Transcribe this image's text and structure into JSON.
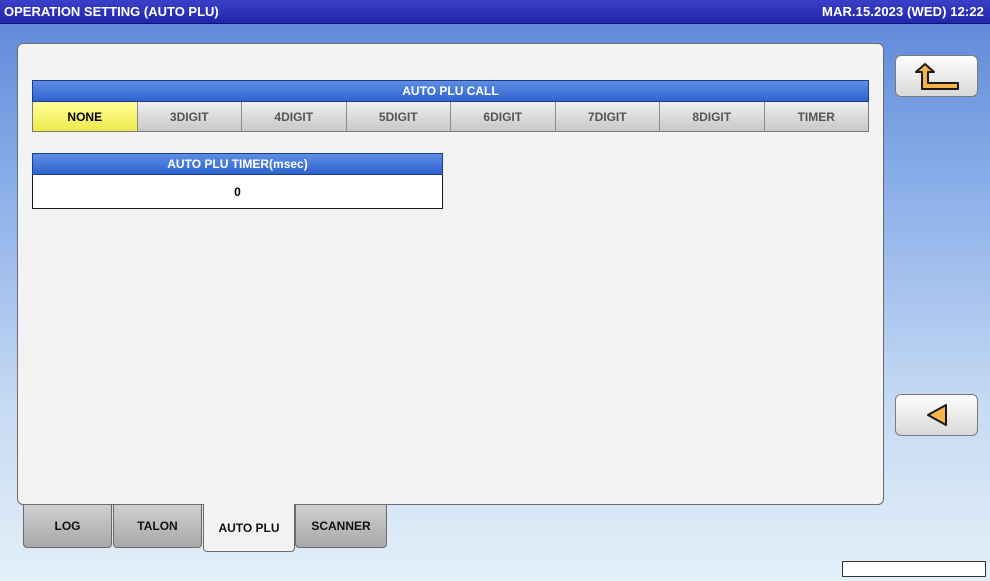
{
  "title": "OPERATION SETTING (AUTO PLU)",
  "datetime": "MAR.15.2023 (WED)  12:22",
  "auto_plu_call": {
    "header": "AUTO PLU CALL",
    "options": [
      "NONE",
      "3DIGIT",
      "4DIGIT",
      "5DIGIT",
      "6DIGIT",
      "7DIGIT",
      "8DIGIT",
      "TIMER"
    ],
    "selected": "NONE"
  },
  "auto_plu_timer": {
    "header": "AUTO PLU TIMER(msec)",
    "value": "0"
  },
  "side_buttons": {
    "return_icon": "return-arrow-icon",
    "prev_icon": "triangle-left-icon"
  },
  "tabs": [
    "LOG",
    "TALON",
    "AUTO PLU",
    "SCANNER"
  ],
  "active_tab": "AUTO PLU",
  "colors": {
    "title_bar": "#2126a8",
    "header_blue": "#2f63d0",
    "selected_yellow": "#f0e94a",
    "icon_orange": "#f5b34a"
  }
}
